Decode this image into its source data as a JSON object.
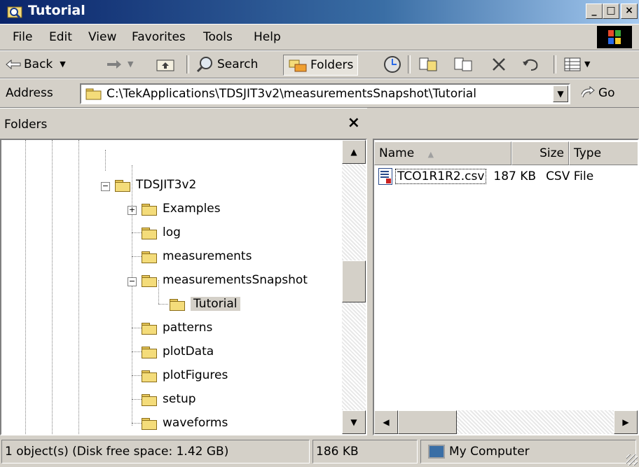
{
  "window": {
    "title": "Tutorial"
  },
  "title_buttons": {
    "minimize": "_",
    "maximize": "□",
    "close": "×"
  },
  "menu": [
    {
      "label": "File"
    },
    {
      "label": "Edit"
    },
    {
      "label": "View"
    },
    {
      "label": "Favorites"
    },
    {
      "label": "Tools"
    },
    {
      "label": "Help"
    }
  ],
  "toolbar": {
    "back_label": "Back",
    "search_label": "Search",
    "folders_label": "Folders",
    "go_label": "Go"
  },
  "address": {
    "label": "Address",
    "path": "C:\\TekApplications\\TDSJIT3v2\\measurementsSnapshot\\Tutorial"
  },
  "folders_pane": {
    "title": "Folders",
    "close": "×",
    "tree": [
      {
        "label": "TDSJIT3v2"
      },
      {
        "label": "Examples"
      },
      {
        "label": "log"
      },
      {
        "label": "measurements"
      },
      {
        "label": "measurementsSnapshot"
      },
      {
        "label": "Tutorial"
      },
      {
        "label": "patterns"
      },
      {
        "label": "plotData"
      },
      {
        "label": "plotFigures"
      },
      {
        "label": "setup"
      },
      {
        "label": "waveforms"
      }
    ]
  },
  "files_pane": {
    "columns": {
      "name": "Name",
      "size": "Size",
      "type": "Type"
    },
    "sort_indicator": "▲",
    "files": [
      {
        "name": "TCO1R1R2.csv",
        "size": "187 KB",
        "type": "CSV File"
      }
    ]
  },
  "status": {
    "objects": "1 object(s) (Disk free space: 1.42 GB)",
    "size": "186 KB",
    "location": "My Computer"
  },
  "icons": [
    "explorer-window-icon",
    "windows-logo-icon",
    "back-arrow-icon",
    "forward-arrow-icon",
    "up-folder-icon",
    "search-icon",
    "folders-icon",
    "history-icon",
    "move-to-icon",
    "copy-to-icon",
    "delete-icon",
    "undo-icon",
    "views-icon",
    "folder-icon",
    "go-arrow-icon",
    "csv-file-icon",
    "my-computer-icon"
  ]
}
